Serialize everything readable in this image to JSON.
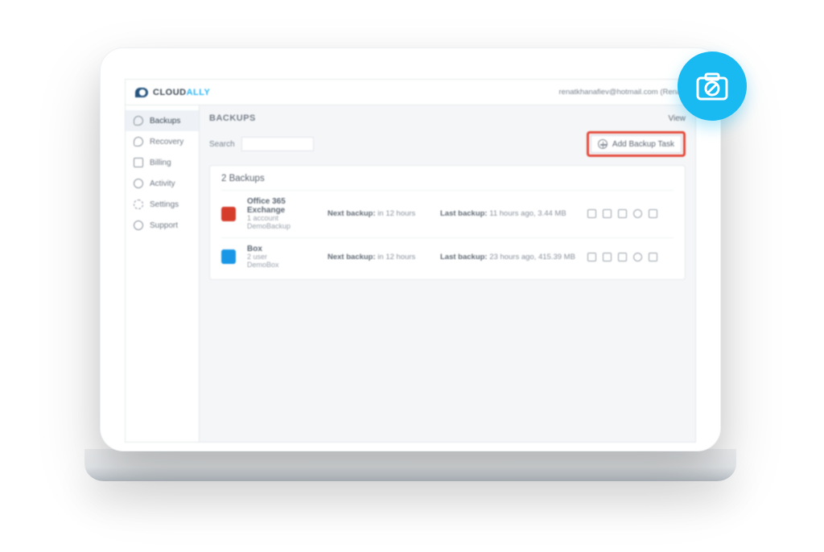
{
  "colors": {
    "accent": "#19b9f2",
    "highlight_border": "#e44b3c",
    "brand_dark": "#23527c",
    "brand_light": "#29b6f6"
  },
  "header": {
    "brand_name": "CLOUD",
    "brand_suffix": "ALLY",
    "user_text": "renatkhanafiev@hotmail.com (Renat)"
  },
  "sidebar": {
    "items": [
      {
        "icon": "cloud-icon",
        "label": "Backups",
        "active": true
      },
      {
        "icon": "cloud-icon",
        "label": "Recovery",
        "active": false
      },
      {
        "icon": "doc-icon",
        "label": "Billing",
        "active": false
      },
      {
        "icon": "user-icon",
        "label": "Activity",
        "active": false
      },
      {
        "icon": "gear-icon",
        "label": "Settings",
        "active": false
      },
      {
        "icon": "help-icon",
        "label": "Support",
        "active": false
      }
    ]
  },
  "page": {
    "title": "BACKUPS",
    "view_label": "View"
  },
  "search": {
    "label": "Search",
    "value": ""
  },
  "add_button": {
    "label": "Add Backup Task"
  },
  "backups": {
    "count_label": "2 Backups",
    "rows": [
      {
        "service": "Office 365 Exchange",
        "line2": "1 account",
        "line3": "DemoBackup",
        "next_label": "Next backup:",
        "next_value": "in 12 hours",
        "last_label": "Last backup:",
        "last_value": "11 hours ago, 3.44 MB",
        "logo_color": "red"
      },
      {
        "service": "Box",
        "line2": "2 user",
        "line3": "DemoBox",
        "next_label": "Next backup:",
        "next_value": "in 12 hours",
        "last_label": "Last backup:",
        "last_value": "23 hours ago, 415.39 MB",
        "logo_color": "blue"
      }
    ],
    "row_actions": [
      "edit-icon",
      "run-icon",
      "download-icon",
      "archive-icon",
      "delete-icon"
    ]
  }
}
